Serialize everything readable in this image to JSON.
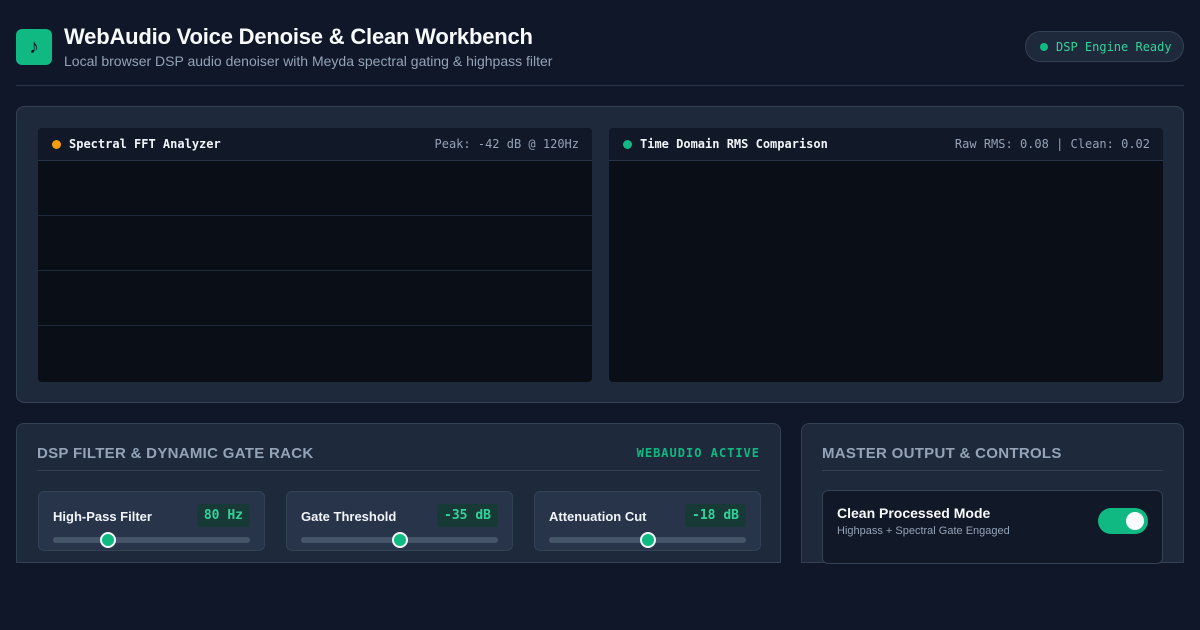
{
  "header": {
    "title": "WebAudio Voice Denoise & Clean Workbench",
    "subtitle": "Local browser DSP audio denoiser with Meyda spectral gating & highpass filter",
    "icon": "music-note-icon",
    "status": "DSP Engine Ready"
  },
  "visualizers": {
    "spectral": {
      "title": "Spectral FFT Analyzer",
      "meta": "Peak: -42 dB @ 120Hz",
      "dot_color": "#f59e0b"
    },
    "rms": {
      "title": "Time Domain RMS Comparison",
      "meta": "Raw RMS: 0.08 | Clean: 0.02",
      "dot_color": "#10b981"
    }
  },
  "rack": {
    "heading": "DSP FILTER & DYNAMIC GATE RACK",
    "badge": "WEBAUDIO ACTIVE",
    "controls": [
      {
        "label": "High-Pass Filter",
        "value": "80 Hz",
        "level": 0.28
      },
      {
        "label": "Gate Threshold",
        "value": "-35 dB",
        "level": 0.5
      },
      {
        "label": "Attenuation Cut",
        "value": "-18 dB",
        "level": 0.5
      }
    ]
  },
  "master": {
    "heading": "MASTER OUTPUT & CONTROLS",
    "toggle": {
      "title": "Clean Processed Mode",
      "description": "Highpass + Spectral Gate Engaged",
      "on": true
    }
  },
  "colors": {
    "accent": "#10b981",
    "background": "#0f1729",
    "panel": "#1e293b",
    "warning": "#f59e0b"
  }
}
